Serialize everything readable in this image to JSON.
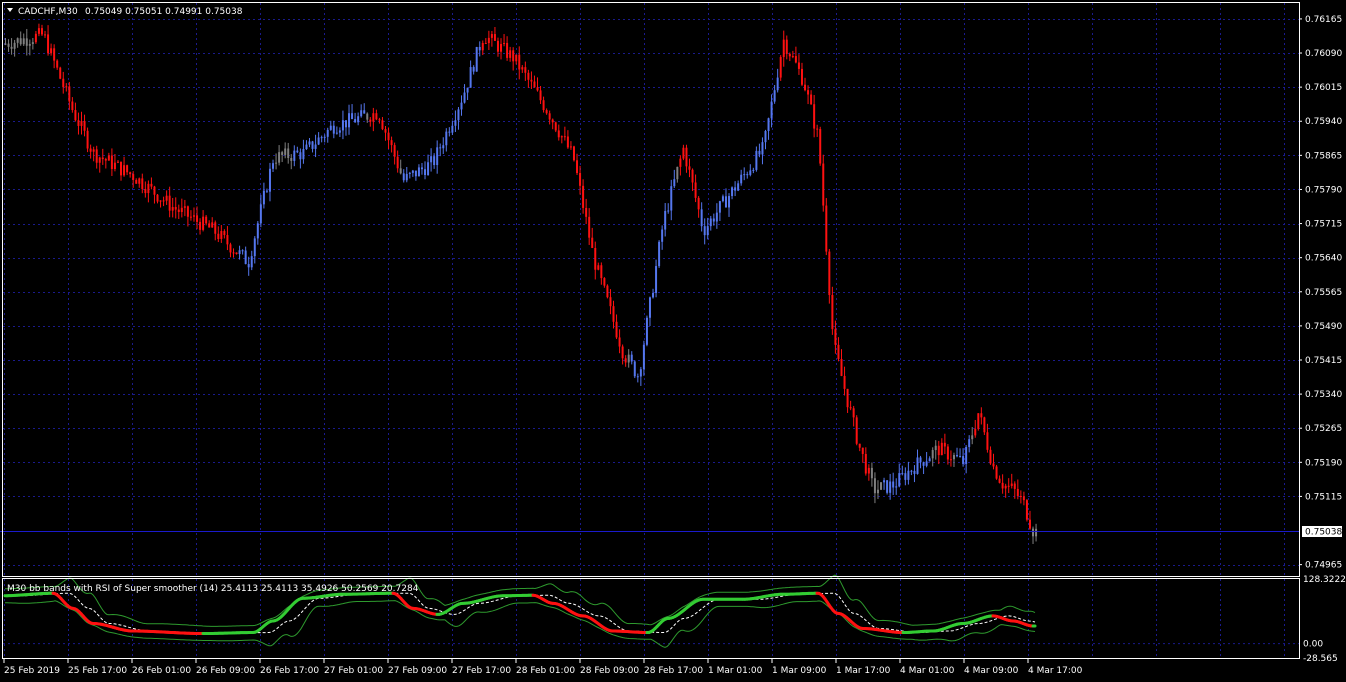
{
  "header": {
    "symbol_title": "CADCHF,M30",
    "ohlc": "0.75049 0.75051 0.74991 0.75038"
  },
  "indicator": {
    "title": "M30 bb bands with RSI of Super smoother (14) 25.4113 25.4113 35.4926 50.2569 20.7284",
    "axis_labels": [
      "128.3222",
      "0.00",
      "-28.565"
    ]
  },
  "price_axis": {
    "labels": [
      "0.76165",
      "0.76090",
      "0.76015",
      "0.75940",
      "0.75865",
      "0.75790",
      "0.75715",
      "0.75640",
      "0.75565",
      "0.75490",
      "0.75415",
      "0.75340",
      "0.75265",
      "0.75190",
      "0.75115",
      "0.74965"
    ],
    "current_price": "0.75038"
  },
  "time_axis": {
    "labels": [
      "25 Feb 2019",
      "25 Feb 17:00",
      "26 Feb 01:00",
      "26 Feb 09:00",
      "26 Feb 17:00",
      "27 Feb 01:00",
      "27 Feb 09:00",
      "27 Feb 17:00",
      "28 Feb 01:00",
      "28 Feb 09:00",
      "28 Feb 17:00",
      "1 Mar 01:00",
      "1 Mar 09:00",
      "1 Mar 17:00",
      "4 Mar 01:00",
      "4 Mar 09:00",
      "4 Mar 17:00"
    ]
  },
  "colors": {
    "background": "#000000",
    "grid": "#1a1a8c",
    "axis_text": "#ffffff",
    "bull": "#5577ee",
    "bear": "#ff1111",
    "neutral": "#808080",
    "signal_up": "#33cc33",
    "signal_down": "#ff1111",
    "band": "#2e9a2e",
    "mid_line": "#ffffff"
  },
  "chart_data": {
    "type": "candlestick",
    "y_unit": "price",
    "ylim": [
      0.7494,
      0.762
    ],
    "anchors": [
      [
        0,
        0.7611
      ],
      [
        0.04,
        0.7613
      ],
      [
        0.07,
        0.7596
      ],
      [
        0.09,
        0.7587
      ],
      [
        0.13,
        0.7582
      ],
      [
        0.17,
        0.7575
      ],
      [
        0.21,
        0.757
      ],
      [
        0.245,
        0.7563
      ],
      [
        0.27,
        0.7586
      ],
      [
        0.3,
        0.7587
      ],
      [
        0.33,
        0.7593
      ],
      [
        0.36,
        0.7595
      ],
      [
        0.375,
        0.7596
      ],
      [
        0.4,
        0.7581
      ],
      [
        0.43,
        0.7585
      ],
      [
        0.46,
        0.76
      ],
      [
        0.48,
        0.7613
      ],
      [
        0.51,
        0.7608
      ],
      [
        0.545,
        0.7596
      ],
      [
        0.57,
        0.7586
      ],
      [
        0.59,
        0.7564
      ],
      [
        0.62,
        0.7543
      ],
      [
        0.635,
        0.7538
      ],
      [
        0.66,
        0.7572
      ],
      [
        0.68,
        0.7588
      ],
      [
        0.7,
        0.757
      ],
      [
        0.73,
        0.7579
      ],
      [
        0.76,
        0.7588
      ],
      [
        0.78,
        0.7612
      ],
      [
        0.8,
        0.7603
      ],
      [
        0.815,
        0.759
      ],
      [
        0.83,
        0.7545
      ],
      [
        0.855,
        0.7523
      ],
      [
        0.87,
        0.7513
      ],
      [
        0.89,
        0.7514
      ],
      [
        0.91,
        0.7518
      ],
      [
        0.935,
        0.7522
      ],
      [
        0.96,
        0.7519
      ],
      [
        0.975,
        0.753
      ],
      [
        0.99,
        0.7518
      ],
      [
        1.0,
        0.7514
      ],
      [
        1.01,
        0.7513
      ],
      [
        1.02,
        0.751
      ],
      [
        1.03,
        0.75038
      ]
    ]
  }
}
